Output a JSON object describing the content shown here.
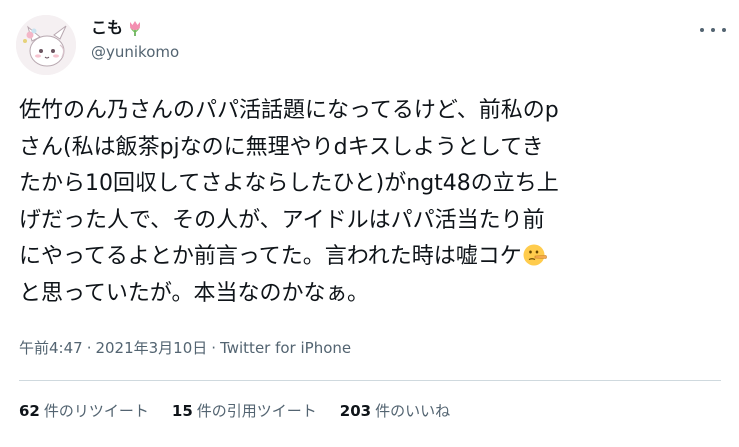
{
  "user": {
    "display_name": "こも",
    "name_emoji": "tulip-icon",
    "handle": "@yunikomo"
  },
  "tweet": {
    "lines": [
      "佐竹のん乃さんのパパ活話題になってるけど、前私のp",
      "さん(私は飯茶pjなのに無理やりdキスしようとしてき",
      "たから10回収してさよならしたひと)がngt48の立ち上",
      "げだった人で、その人が、アイドルはパパ活当たり前",
      "にやってるよとか前言ってた。言われた時は嘘コケ",
      "と思っていたが。本当なのかなぁ。"
    ],
    "line5_emoji": "lying-face-icon"
  },
  "meta": {
    "time": "午前4:47",
    "separator1": "·",
    "date": "2021年3月10日",
    "separator2": "·",
    "source": "Twitter for iPhone"
  },
  "stats": {
    "retweets_count": "62",
    "retweets_label": "件のリツイート",
    "quotes_count": "15",
    "quotes_label": "件の引用ツイート",
    "likes_count": "203",
    "likes_label": "件のいいね"
  },
  "colors": {
    "text": "#0f1419",
    "secondary": "#536471",
    "divider": "#cfd9de"
  }
}
